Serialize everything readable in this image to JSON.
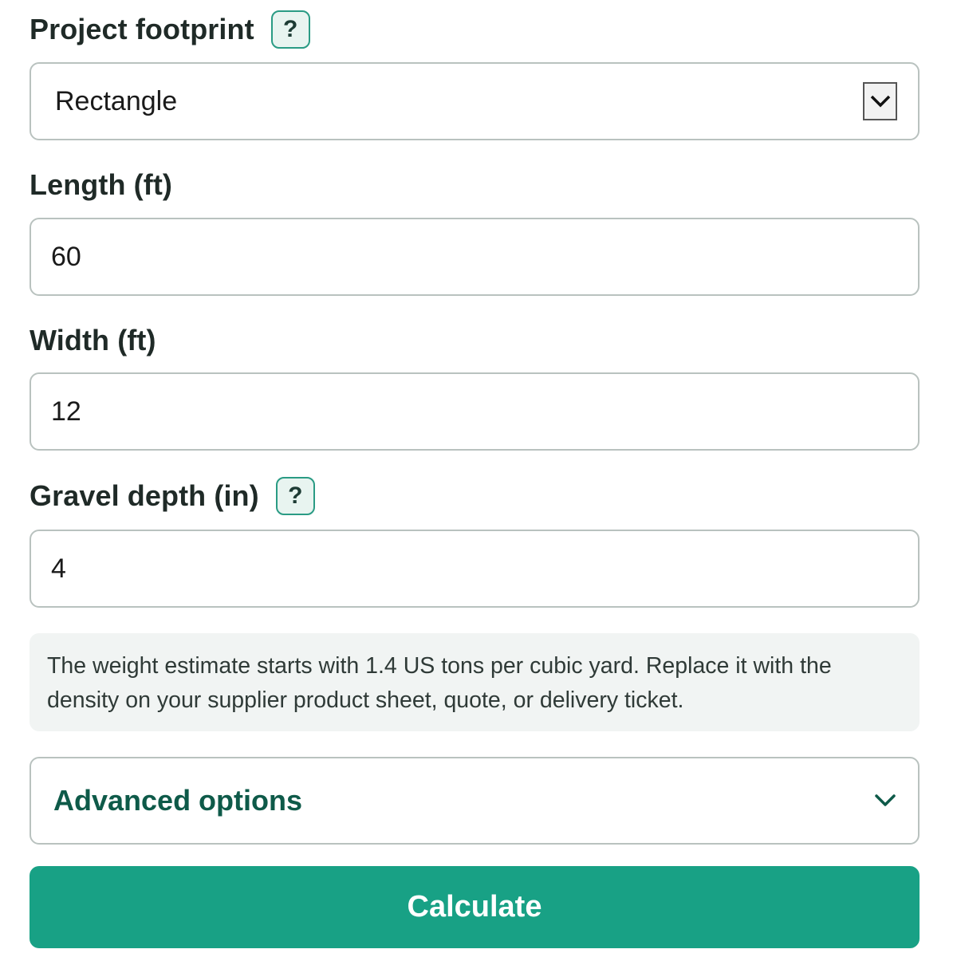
{
  "footprint": {
    "label": "Project footprint",
    "help": "?",
    "selected": "Rectangle",
    "arrow_icon": "chevron-down-icon"
  },
  "length": {
    "label": "Length (ft)",
    "value": "60"
  },
  "width": {
    "label": "Width (ft)",
    "value": "12"
  },
  "depth": {
    "label": "Gravel depth (in)",
    "help": "?",
    "value": "4"
  },
  "note": {
    "line1": "The weight estimate starts with 1.4 US tons per cubic yard. Replace it with the",
    "line2": "density on your supplier product sheet, quote, or delivery ticket."
  },
  "advanced": {
    "label": "Advanced options",
    "icon": "chevron-down-icon"
  },
  "calculate": {
    "label": "Calculate"
  },
  "colors": {
    "accent": "#18a185",
    "accent_dark": "#0e5a49",
    "help_bg": "#e8f4f0",
    "border": "#b9c2bf",
    "note_bg": "#f1f4f3"
  }
}
